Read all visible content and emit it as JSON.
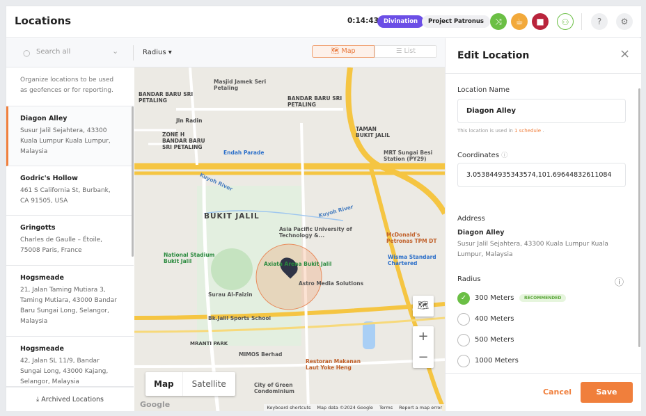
{
  "header": {
    "title": "Locations",
    "timer": "0:14:43",
    "tag_primary": "Divination",
    "tag_secondary": "Project Patronus",
    "accent": "#6b4ee6"
  },
  "toolbar": {
    "search_placeholder": "Search all",
    "radius_label": "Radius",
    "view_map": "Map",
    "view_list": "List"
  },
  "sidebar": {
    "intro": "Organize locations to be used as geofences or for reporting.",
    "archived": "Archived Locations",
    "items": [
      {
        "name": "Diagon Alley",
        "address": "Susur Jalil Sejahtera, 43300 Kuala Lumpur Kuala Lumpur, Malaysia"
      },
      {
        "name": "Godric's Hollow",
        "address": "461 S California St, Burbank, CA 91505, USA"
      },
      {
        "name": "Gringotts",
        "address": "Charles de Gaulle – Étoile, 75008 Paris, France"
      },
      {
        "name": "Hogsmeade",
        "address": "21, Jalan Taming Mutiara 3, Taming Mutiara, 43000 Bandar Baru Sungai Long, Selangor, Malaysia"
      },
      {
        "name": "Hogsmeade",
        "address": "42, Jalan SL 11/9, Bandar Sungai Long, 43000 Kajang, Selangor, Malaysia"
      }
    ]
  },
  "map": {
    "type_map": "Map",
    "type_satellite": "Satellite",
    "attribution": [
      "Keyboard shortcuts",
      "Map data ©2024 Google",
      "Terms",
      "Report a map error"
    ],
    "labels": [
      "BANDAR BARU SRI PETALING",
      "Masjid Jamek Seri Petaling",
      "BANDAR BARU SRI PETALING",
      "Jln Radin",
      "Endah Parade",
      "BUKIT JALIL",
      "Asia Pacific University of Technology &...",
      "Axiata Arena Bukit Jalil",
      "Astro Media Solutions",
      "National Stadium Bukit Jalil",
      "Surau Al-Faizin",
      "Bk.Jalil Sports School",
      "MIMOS Berhad",
      "MRANTI PARK",
      "City of Green Condominium",
      "Restoran Makanan Laut Yoke Heng",
      "McDonald's Petronas TPM DT",
      "Wisma Standard Chartered",
      "MRT Sungai Besi Station (PY29)",
      "Kuyoh River",
      "Kuyoh River",
      "TAMAN BUKIT JALIL",
      "ZONE H BANDAR BARU SRI PETALING",
      "Google"
    ]
  },
  "edit": {
    "title": "Edit Location",
    "name_label": "Location Name",
    "name_value": "Diagon Alley",
    "usage_prefix": "This location is used in",
    "usage_link": "1 schedule",
    "usage_suffix": ".",
    "coords_label": "Coordinates",
    "coords_value": "3.053844935343574,101.69644832611084",
    "address_label": "Address",
    "address_name": "Diagon Alley",
    "address_text": "Susur Jalil Sejahtera, 43300 Kuala Lumpur Kuala Lumpur, Malaysia",
    "radius_label": "Radius",
    "recommended": "RECOMMENDED",
    "radius_options": [
      {
        "label": "300 Meters",
        "selected": true
      },
      {
        "label": "400 Meters",
        "selected": false
      },
      {
        "label": "500 Meters",
        "selected": false
      },
      {
        "label": "1000 Meters",
        "selected": false
      }
    ],
    "cancel": "Cancel",
    "save": "Save",
    "brand": "#f07f3c"
  }
}
